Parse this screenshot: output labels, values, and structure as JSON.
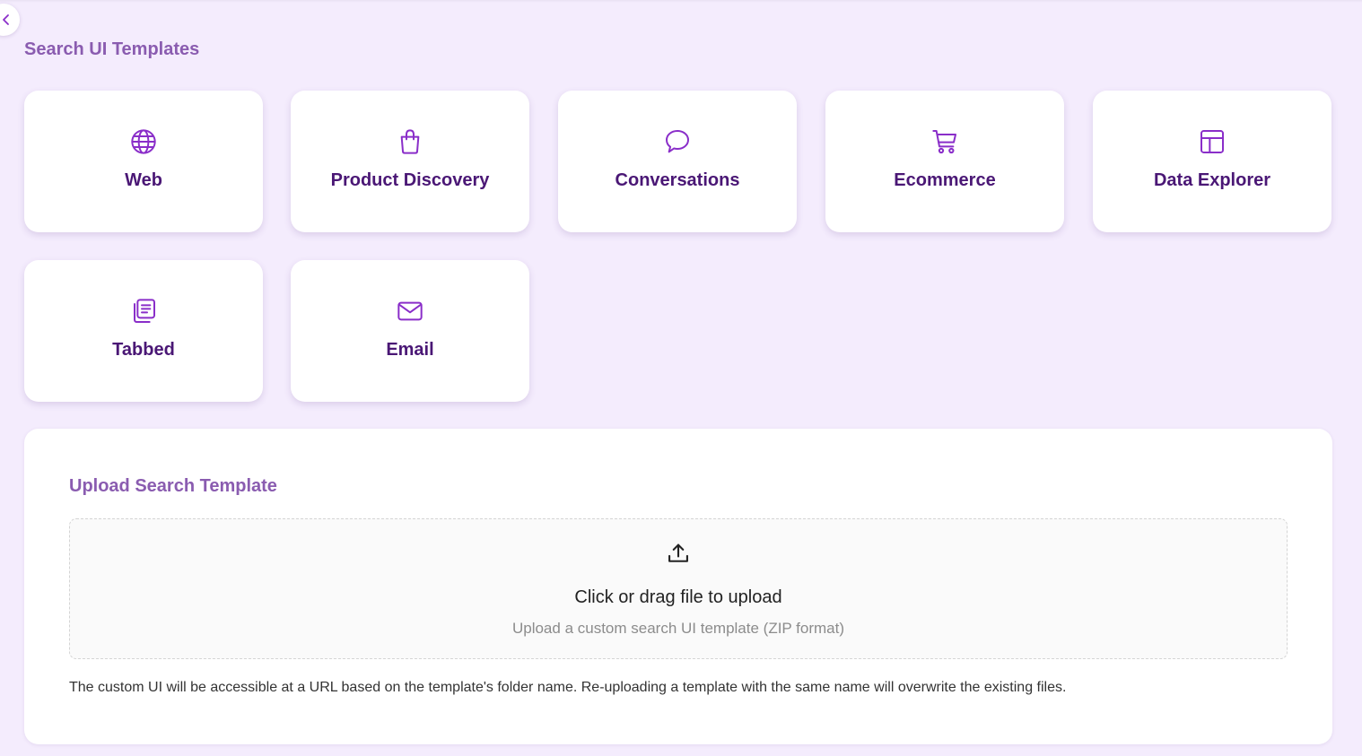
{
  "header": {
    "title": "Search UI Templates"
  },
  "templates": [
    {
      "label": "Web",
      "icon": "globe-icon"
    },
    {
      "label": "Product Discovery",
      "icon": "shopping-bag-icon"
    },
    {
      "label": "Conversations",
      "icon": "chat-bubble-icon"
    },
    {
      "label": "Ecommerce",
      "icon": "shopping-cart-icon"
    },
    {
      "label": "Data Explorer",
      "icon": "table-grid-icon"
    },
    {
      "label": "Tabbed",
      "icon": "stacked-documents-icon"
    },
    {
      "label": "Email",
      "icon": "envelope-icon"
    }
  ],
  "upload": {
    "title": "Upload Search Template",
    "dropzone_primary": "Click or drag file to upload",
    "dropzone_secondary": "Upload a custom search UI template (ZIP format)",
    "note": "The custom UI will be accessible at a URL based on the template's folder name. Re-uploading a template with the same name will overwrite the existing files."
  },
  "colors": {
    "background": "#f4ecfd",
    "accent": "#8a2ec9",
    "card_label": "#4a1775",
    "section_title": "#8a5cb0"
  }
}
